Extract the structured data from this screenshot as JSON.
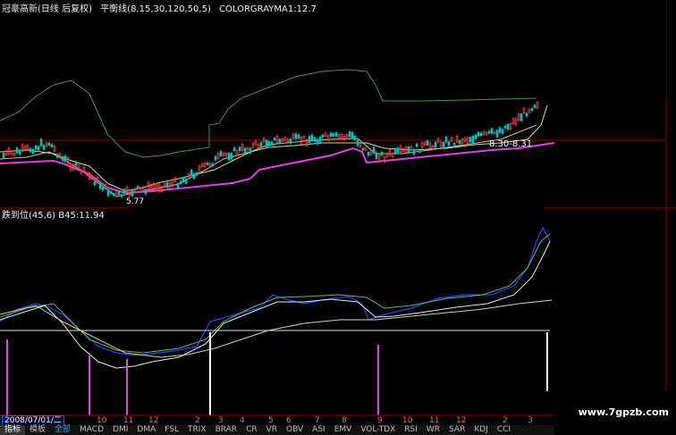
{
  "main_panel": {
    "title_parts": [
      "冠豪高新(日线 后复权)",
      "平衡线(8,15,30,120,50,5)",
      "COLORGRAYMA1:12.7"
    ],
    "price_tag": "8.30-8.31",
    "low_tag": "5.77"
  },
  "sub_panel": {
    "title": "跌到位(45,6)",
    "value": "B45:11.94"
  },
  "timeline": {
    "date": "2008/07/01/二",
    "months": [
      "10",
      "11",
      "12",
      "2",
      "3",
      "4",
      "5",
      "6",
      "7",
      "8",
      "9",
      "10",
      "11",
      "12",
      "2",
      "3"
    ]
  },
  "tabs": {
    "items": [
      "指标",
      "模板",
      "全部",
      "MACD",
      "DMI",
      "DMA",
      "FSL",
      "TRIX",
      "BRAR",
      "CR",
      "VR",
      "OBV",
      "ASI",
      "EMV",
      "VOL-TDX",
      "RSI",
      "WR",
      "SAR",
      "KDJ",
      "CCI"
    ],
    "selected": "全部"
  },
  "watermark": "www.7gpzb.com",
  "colors": {
    "background": "#000000",
    "support": "#e040e0",
    "upper_band": "#3a9a3a",
    "ma_band": "#d8d890",
    "candle_up": "#ff4444",
    "candle_down": "#00c0c0",
    "signal": "#d050d0",
    "line_blue": "#3040ff"
  }
}
